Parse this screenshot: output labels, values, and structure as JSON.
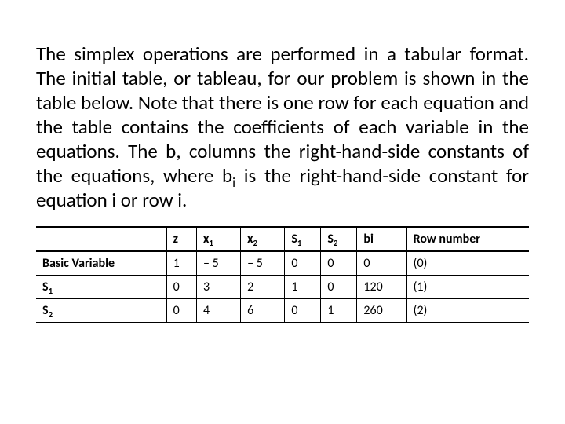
{
  "paragraph": {
    "p1a": "The simplex operations are performed in a tabular format. The initial table, or tableau, for our problem is shown in the table below. Note that there is one row for each equation and the table contains the coefficients of each variable in the equations. The b, columns the right-hand-side constants of the equations, where b",
    "p1_sub": "i",
    "p1b": " is the right-hand-side constant for equation i or row i."
  },
  "table": {
    "headers": {
      "h0": "",
      "h1": "z",
      "h2a": "x",
      "h2s": "1",
      "h3a": "x",
      "h3s": "2",
      "h4a": "S",
      "h4s": "1",
      "h5a": "S",
      "h5s": "2",
      "h6": "bi",
      "h7": "Row number"
    },
    "rows": [
      {
        "r0": "Basic Variable",
        "r1": "1",
        "r2": "– 5",
        "r3": "– 5",
        "r4": "0",
        "r5": "0",
        "r6": "0",
        "r7": "(0)"
      },
      {
        "r0a": "S",
        "r0s": "1",
        "r1": "0",
        "r2": "3",
        "r3": "2",
        "r4": "1",
        "r5": "0",
        "r6": "120",
        "r7": "(1)"
      },
      {
        "r0a": "S",
        "r0s": "2",
        "r1": "0",
        "r2": "4",
        "r3": "6",
        "r4": "0",
        "r5": "1",
        "r6": "260",
        "r7": "(2)"
      }
    ]
  }
}
